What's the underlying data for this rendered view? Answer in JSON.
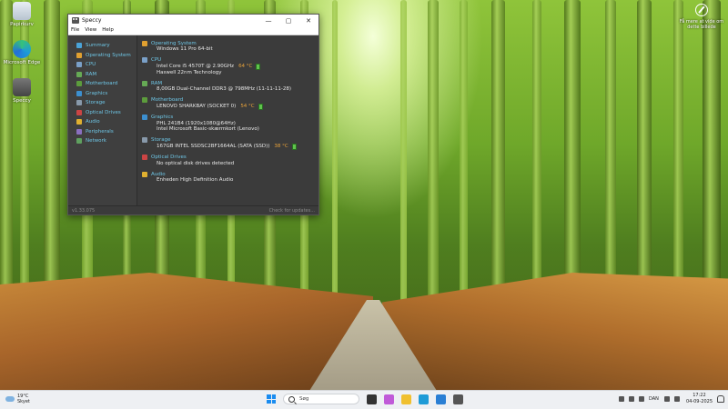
{
  "desktop": {
    "icons": [
      {
        "label": "Papirkurv"
      },
      {
        "label": "Microsoft Edge"
      },
      {
        "label": "Speccy"
      }
    ],
    "top_right_text": "Få mere at vide om dette billede"
  },
  "window": {
    "title": "Speccy",
    "menu": [
      "File",
      "View",
      "Help"
    ],
    "sidebar": [
      {
        "label": "Summary",
        "color": "#4aa3d8"
      },
      {
        "label": "Operating System",
        "color": "#e0a030"
      },
      {
        "label": "CPU",
        "color": "#7aa0c8"
      },
      {
        "label": "RAM",
        "color": "#66aa55"
      },
      {
        "label": "Motherboard",
        "color": "#5c9c3c"
      },
      {
        "label": "Graphics",
        "color": "#3c8fcf"
      },
      {
        "label": "Storage",
        "color": "#8899aa"
      },
      {
        "label": "Optical Drives",
        "color": "#cc4444"
      },
      {
        "label": "Audio",
        "color": "#e0b030"
      },
      {
        "label": "Peripherals",
        "color": "#8a6fbf"
      },
      {
        "label": "Network",
        "color": "#5fa05f"
      }
    ],
    "summary": [
      {
        "head": "Operating System",
        "color": "#e0a030",
        "lines": [
          {
            "text": "Windows 11 Pro 64-bit",
            "temp": ""
          }
        ]
      },
      {
        "head": "CPU",
        "color": "#7aa0c8",
        "lines": [
          {
            "text": "Intel Core i5 4570T @ 2.90GHz",
            "temp": "64 °C"
          },
          {
            "text": "Haswell 22nm Technology",
            "temp": ""
          }
        ]
      },
      {
        "head": "RAM",
        "color": "#66aa55",
        "lines": [
          {
            "text": "8,00GB Dual-Channel DDR3 @ 798MHz (11-11-11-28)",
            "temp": ""
          }
        ]
      },
      {
        "head": "Motherboard",
        "color": "#5c9c3c",
        "lines": [
          {
            "text": "LENOVO SHARKBAY (SOCKET 0)",
            "temp": "54 °C"
          }
        ]
      },
      {
        "head": "Graphics",
        "color": "#3c8fcf",
        "lines": [
          {
            "text": "PHL 241B4 (1920x1080@64Hz)",
            "temp": ""
          },
          {
            "text": "Intel Microsoft Basic-skærmkort (Lenovo)",
            "temp": ""
          }
        ]
      },
      {
        "head": "Storage",
        "color": "#8899aa",
        "lines": [
          {
            "text": "167GB INTEL SSDSC2BF1664AL (SATA (SSD))",
            "temp": "38 °C"
          }
        ]
      },
      {
        "head": "Optical Drives",
        "color": "#cc4444",
        "lines": [
          {
            "text": "No optical disk drives detected",
            "temp": ""
          }
        ]
      },
      {
        "head": "Audio",
        "color": "#e0b030",
        "lines": [
          {
            "text": "Enheden High Definition Audio",
            "temp": ""
          }
        ]
      }
    ],
    "version": "v1.33.075",
    "update_link": "Check for updates..."
  },
  "taskbar": {
    "weather_temp": "19°C",
    "weather_desc": "Skyet",
    "search_placeholder": "Søg",
    "apps": [
      {
        "name": "task-view",
        "color": "#333333"
      },
      {
        "name": "copilot",
        "color": "#c05ad8"
      },
      {
        "name": "file-explorer",
        "color": "#f0c030"
      },
      {
        "name": "edge",
        "color": "#1e9bd7"
      },
      {
        "name": "store",
        "color": "#2a7fd4"
      },
      {
        "name": "speccy",
        "color": "#555555"
      }
    ],
    "lang": "DAN",
    "time": "17:22",
    "date": "04-09-2025"
  }
}
